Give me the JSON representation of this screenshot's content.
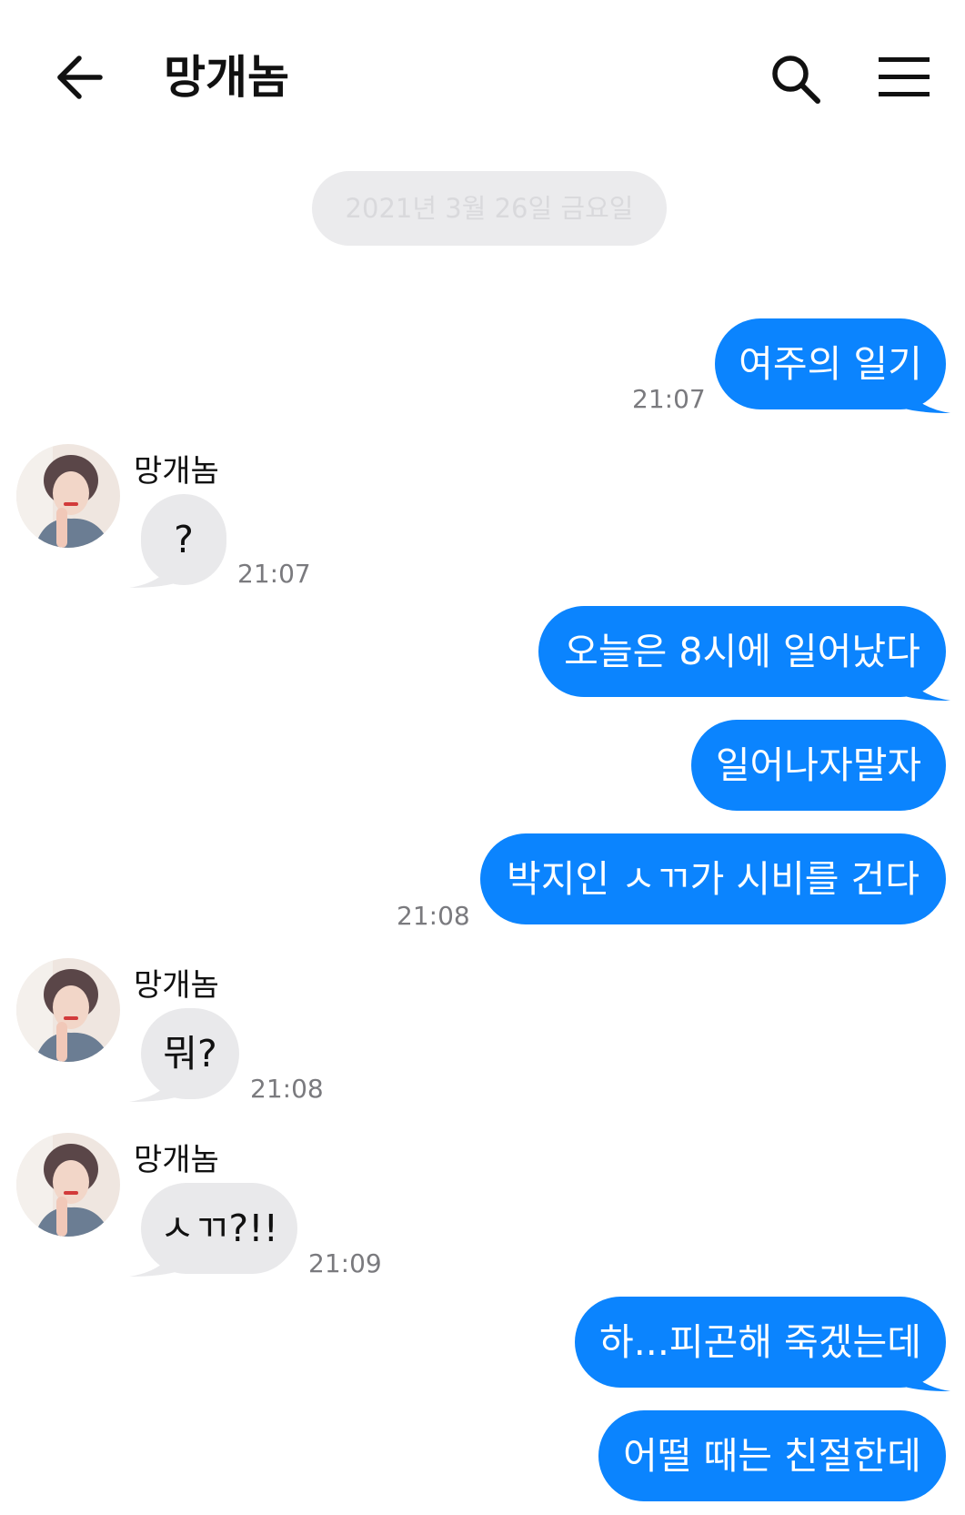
{
  "header": {
    "title": "망개놈",
    "back_icon": "arrow-left-icon",
    "search_icon": "search-icon",
    "menu_icon": "hamburger-menu-icon"
  },
  "date_separator": "2021년 3월 26일 금요일",
  "colors": {
    "sent_bubble": "#0b84fe",
    "received_bubble": "#e9e9eb",
    "date_pill": "#ebebed"
  },
  "messages": [
    {
      "direction": "sent",
      "text": "여주의 일기",
      "time": "21:07"
    },
    {
      "direction": "received",
      "sender": "망개놈",
      "text": "?",
      "time": "21:07"
    },
    {
      "direction": "sent",
      "text": "오늘은 8시에 일어났다"
    },
    {
      "direction": "sent",
      "text": "일어나자말자"
    },
    {
      "direction": "sent",
      "text": "박지인 ㅅㄲ가 시비를 건다",
      "time": "21:08"
    },
    {
      "direction": "received",
      "sender": "망개놈",
      "text": "뭐?",
      "time": "21:08"
    },
    {
      "direction": "received",
      "sender": "망개놈",
      "text": "ㅅㄲ?!!",
      "time": "21:09"
    },
    {
      "direction": "sent",
      "text": "하...피곤해 죽겠는데"
    },
    {
      "direction": "sent",
      "text": "어떨 때는 친절한데"
    }
  ]
}
